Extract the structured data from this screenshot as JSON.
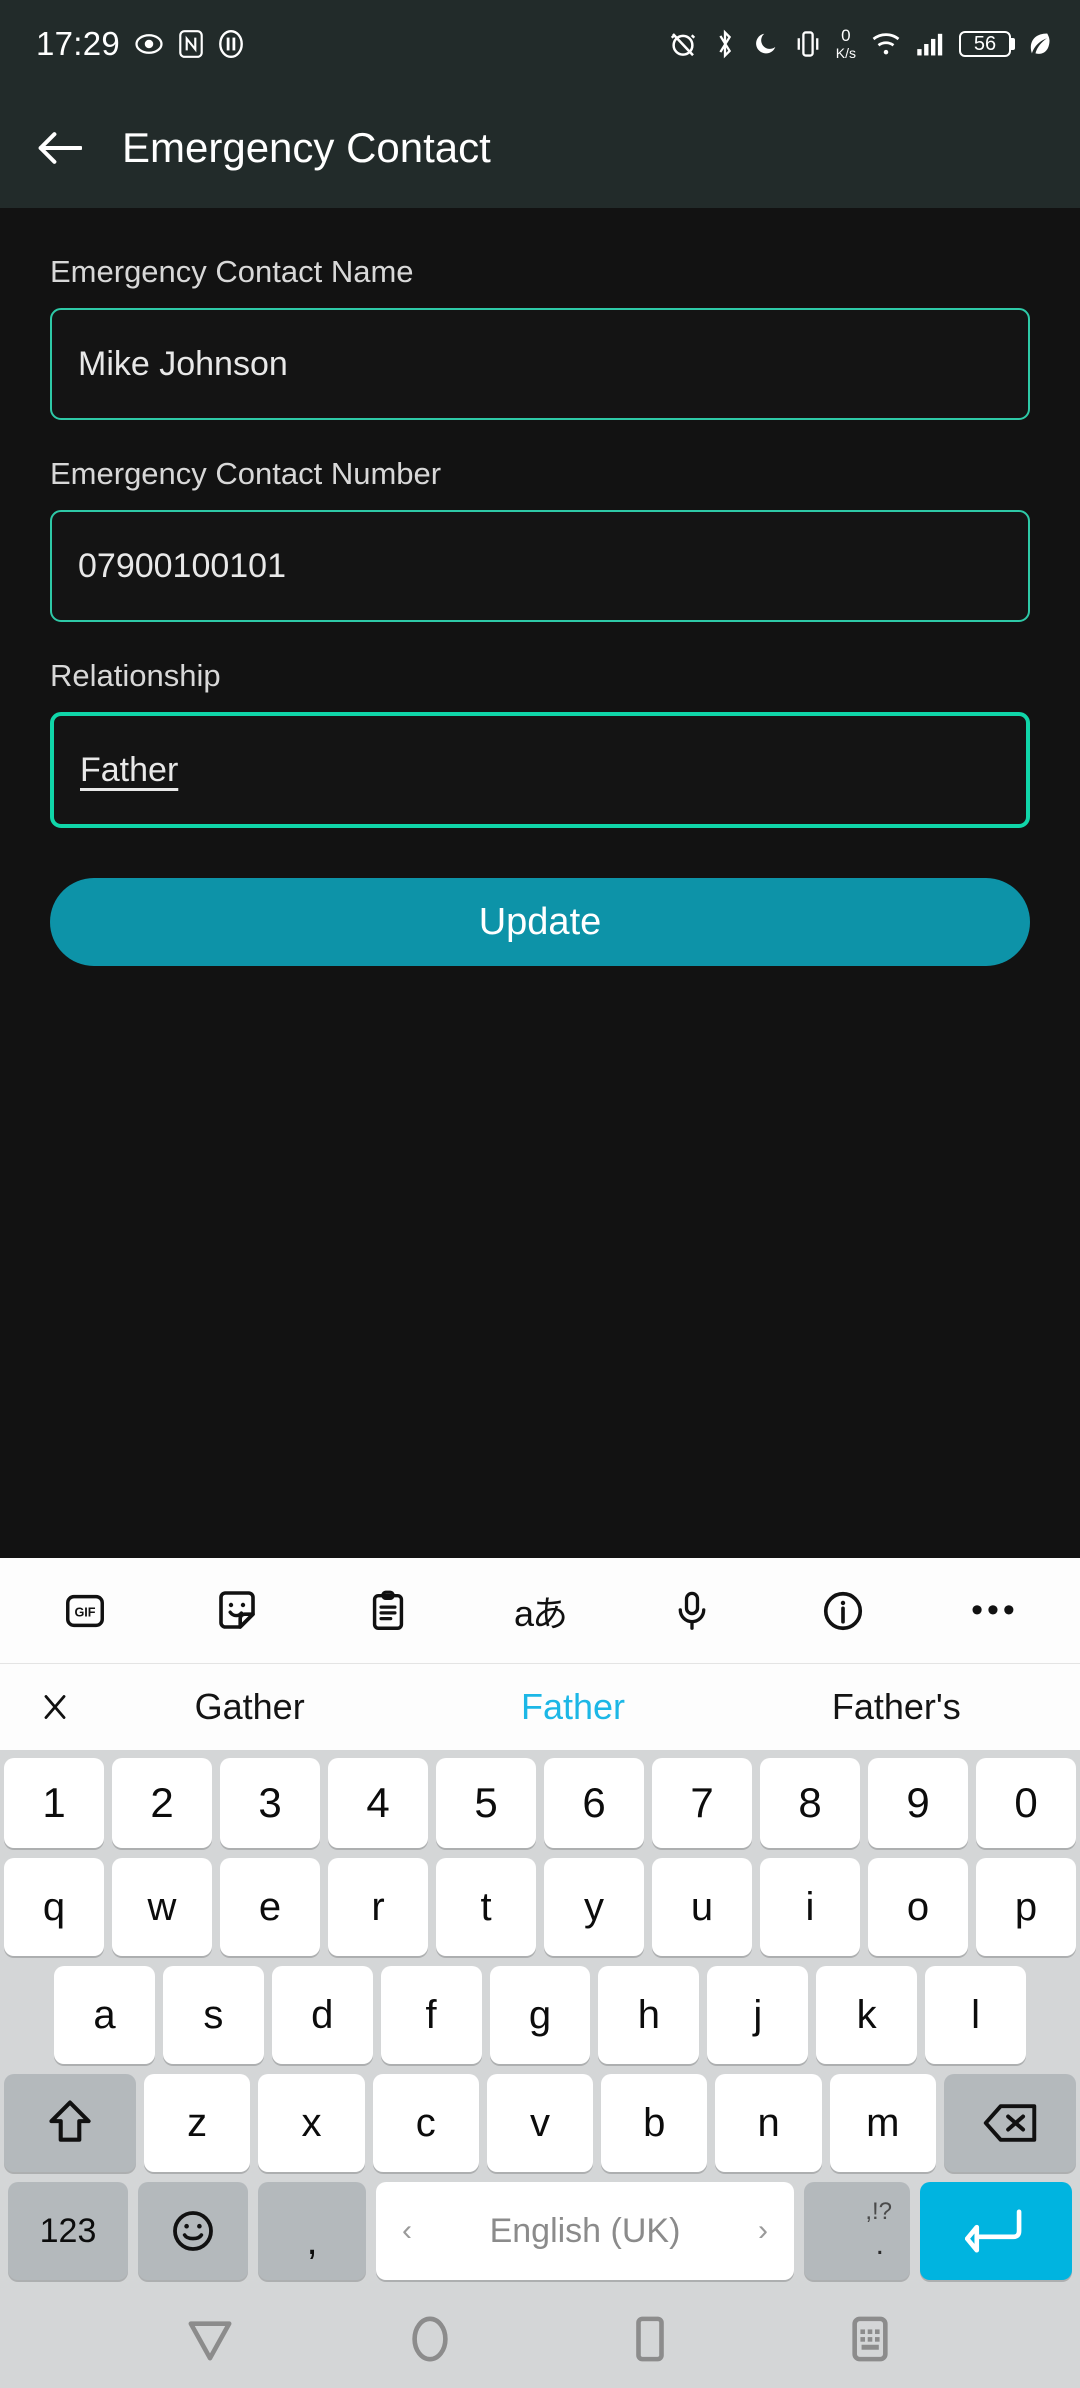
{
  "status_bar": {
    "time": "17:29",
    "left_icons": [
      "eye-icon",
      "nfc-icon",
      "pause-icon"
    ],
    "right_icons": [
      "alarm-off-icon",
      "bluetooth-icon",
      "do-not-disturb-moon-icon",
      "vibrate-icon",
      "wifi-icon",
      "cellular-signal-icon",
      "eco-leaf-icon"
    ],
    "network_speed_value": "0",
    "network_speed_unit": "K/s",
    "battery_level": "56"
  },
  "app_bar": {
    "back_icon": "arrow-left-icon",
    "title": "Emergency Contact"
  },
  "form": {
    "fields": [
      {
        "label": "Emergency Contact Name",
        "value": "Mike Johnson",
        "focused": false
      },
      {
        "label": "Emergency Contact Number",
        "value": "07900100101",
        "focused": false
      },
      {
        "label": "Relationship",
        "value": "Father",
        "focused": true
      }
    ],
    "submit_label": "Update"
  },
  "keyboard": {
    "toolbar": [
      "gif-icon",
      "sticker-icon",
      "clipboard-icon",
      "language-icon",
      "microphone-icon",
      "info-icon",
      "more-options-icon"
    ],
    "language_glyph": "aあ",
    "suggestions": [
      {
        "text": "Gather",
        "active": false
      },
      {
        "text": "Father",
        "active": true
      },
      {
        "text": "Father's",
        "active": false
      }
    ],
    "close_suggestions_icon": "close-icon",
    "rows": {
      "numbers": [
        "1",
        "2",
        "3",
        "4",
        "5",
        "6",
        "7",
        "8",
        "9",
        "0"
      ],
      "top": [
        "q",
        "w",
        "e",
        "r",
        "t",
        "y",
        "u",
        "i",
        "o",
        "p"
      ],
      "home": [
        "a",
        "s",
        "d",
        "f",
        "g",
        "h",
        "j",
        "k",
        "l"
      ],
      "bottom": [
        "z",
        "x",
        "c",
        "v",
        "b",
        "n",
        "m"
      ]
    },
    "shift_icon": "shift-arrow-icon",
    "backspace_icon": "backspace-icon",
    "numeric_key_label": "123",
    "emoji_icon": "emoji-smiley-icon",
    "comma_label": ",",
    "space_label": "English (UK)",
    "space_prev_arrow": "‹",
    "space_next_arrow": "›",
    "punct_top_label": ",!?",
    "punct_bottom_label": ".",
    "enter_icon": "enter-return-icon"
  },
  "nav_bar": {
    "items": [
      "back-triangle-icon",
      "home-circle-icon",
      "recents-square-icon",
      "hide-keyboard-icon"
    ]
  },
  "colors": {
    "accent_teal": "#0d93a8",
    "field_border": "#2ec9a7",
    "field_border_focused": "#10d6a9",
    "suggestion_active": "#1cb7e6",
    "enter_key": "#00b4e0"
  }
}
